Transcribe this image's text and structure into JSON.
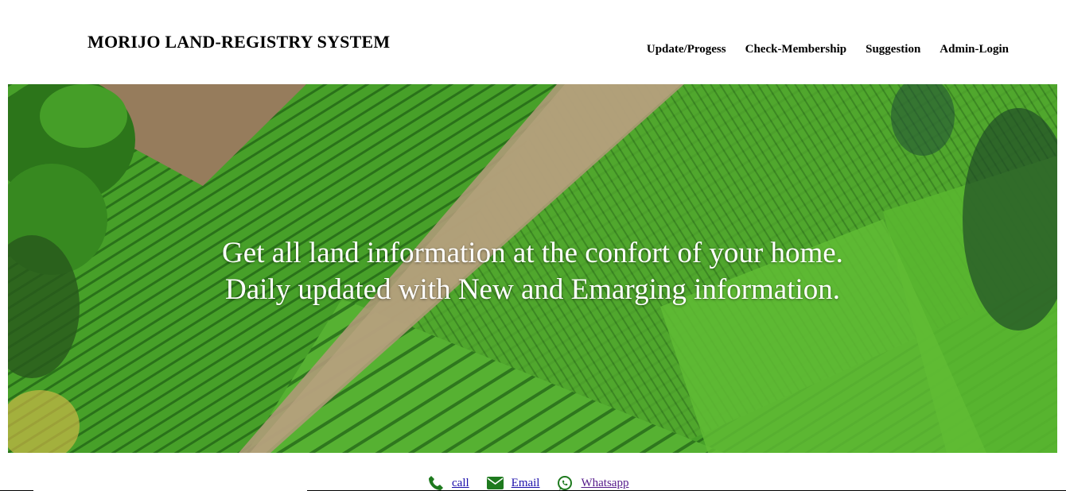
{
  "header": {
    "site_title": "MORIJO LAND-REGISTRY SYSTEM",
    "nav": [
      {
        "label": "Update/Progess"
      },
      {
        "label": "Check-Membership"
      },
      {
        "label": "Suggestion"
      },
      {
        "label": "Admin-Login"
      }
    ]
  },
  "hero": {
    "line1": "Get all land information at the confort of your home.",
    "line2": "Daily updated with New and Emarging information."
  },
  "contacts": [
    {
      "label": "call",
      "icon": "phone-icon",
      "color": "#1e7a1e"
    },
    {
      "label": "Email",
      "icon": "envelope-icon",
      "color": "#1e7a1e"
    },
    {
      "label": "Whatsapp",
      "icon": "whatsapp-icon",
      "color": "#1e7a1e"
    }
  ]
}
